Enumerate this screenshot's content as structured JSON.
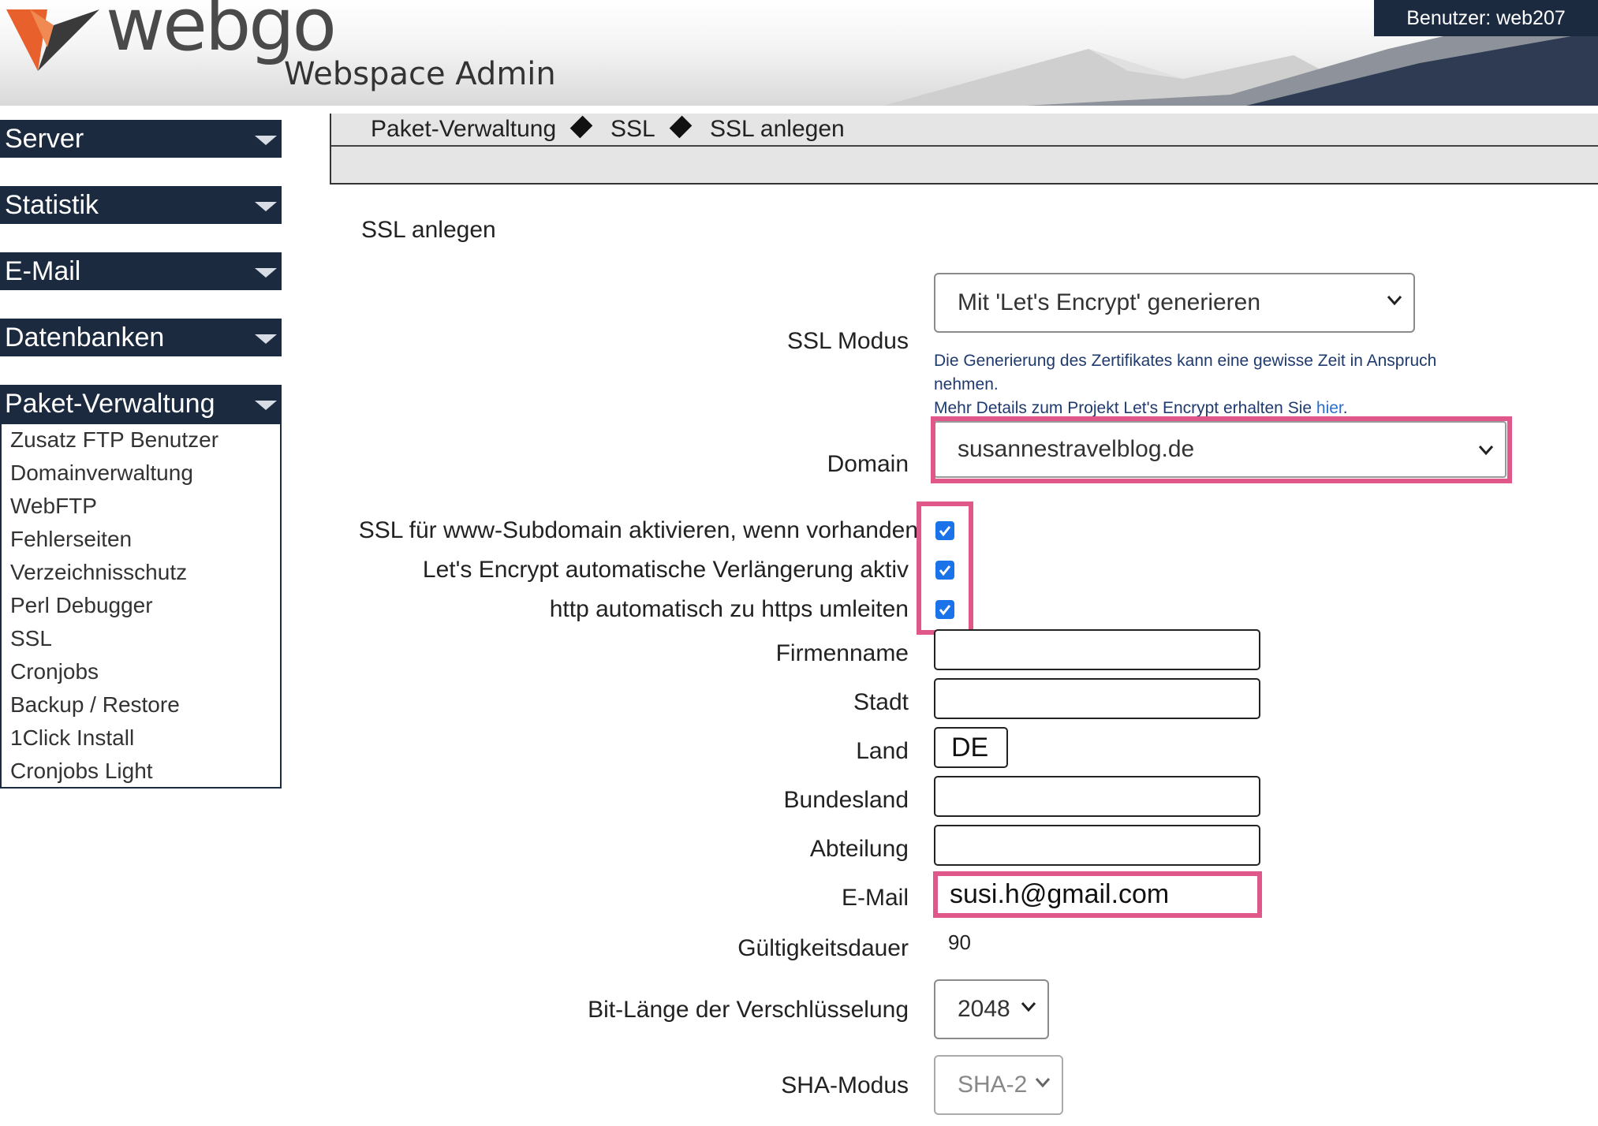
{
  "header": {
    "logo_text": "webgo",
    "logo_subtitle": "Webspace Admin",
    "user_badge": "Benutzer: web207"
  },
  "sidebar": {
    "sections": [
      {
        "label": "Server"
      },
      {
        "label": "Statistik"
      },
      {
        "label": "E-Mail"
      },
      {
        "label": "Datenbanken"
      },
      {
        "label": "Paket-Verwaltung"
      }
    ],
    "subitems": [
      "Zusatz FTP Benutzer",
      "Domainverwaltung",
      "WebFTP",
      "Fehlerseiten",
      "Verzeichnisschutz",
      "Perl Debugger",
      "SSL",
      "Cronjobs",
      "Backup / Restore",
      "1Click Install",
      "Cronjobs Light"
    ]
  },
  "breadcrumb": [
    "Paket-Verwaltung",
    "SSL",
    "SSL anlegen"
  ],
  "form": {
    "title": "SSL anlegen",
    "ssl_mode": {
      "label": "SSL Modus",
      "value": "Mit 'Let's Encrypt' generieren",
      "info_line1": "Die Generierung des Zertifikates kann eine gewisse Zeit in Anspruch",
      "info_line2": "nehmen.",
      "info_line3": "Mehr Details zum Projekt Let's Encrypt erhalten Sie ",
      "info_link": "hier",
      "info_end": "."
    },
    "domain": {
      "label": "Domain",
      "value": "susannestravelblog.de"
    },
    "checkboxes": [
      {
        "label": "SSL für www-Subdomain aktivieren, wenn vorhanden",
        "checked": true
      },
      {
        "label": "Let's Encrypt automatische Verlängerung aktiv",
        "checked": true
      },
      {
        "label": "http automatisch zu https umleiten",
        "checked": true
      }
    ],
    "fields": {
      "firmenname": {
        "label": "Firmenname",
        "value": ""
      },
      "stadt": {
        "label": "Stadt",
        "value": ""
      },
      "land": {
        "label": "Land",
        "value": "DE"
      },
      "bundesland": {
        "label": "Bundesland",
        "value": ""
      },
      "abteilung": {
        "label": "Abteilung",
        "value": ""
      },
      "email": {
        "label": "E-Mail",
        "value": "susi.h@gmail.com"
      }
    },
    "validity": {
      "label": "Gültigkeitsdauer",
      "value": "90"
    },
    "bit_length": {
      "label": "Bit-Länge der Verschlüsselung",
      "value": "2048"
    },
    "sha_mode": {
      "label": "SHA-Modus",
      "value": "SHA-2"
    }
  },
  "colors": {
    "nav_bg": "#1c2a40",
    "highlight": "#e0578a",
    "checkbox": "#1a73e8",
    "logo_orange": "#e8612c"
  }
}
